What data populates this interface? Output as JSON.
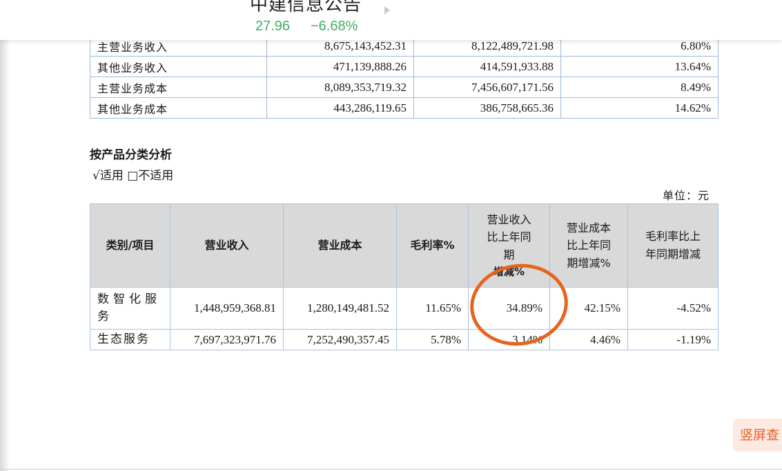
{
  "header": {
    "stock_name": "中建信息公告",
    "price": "27.96",
    "change": "−6.68%"
  },
  "summary_table": {
    "rows": [
      {
        "label": "主营业务收入",
        "current": "8,675,143,452.31",
        "previous": "8,122,489,721.98",
        "change": "6.80%"
      },
      {
        "label": "其他业务收入",
        "current": "471,139,888.26",
        "previous": "414,591,933.88",
        "change": "13.64%"
      },
      {
        "label": "主营业务成本",
        "current": "8,089,353,719.32",
        "previous": "7,456,607,171.56",
        "change": "8.49%"
      },
      {
        "label": "其他业务成本",
        "current": "443,286,119.65",
        "previous": "386,758,665.36",
        "change": "14.62%"
      }
    ]
  },
  "section": {
    "title": "按产品分类分析",
    "applicable": "√适用 □不适用",
    "unit": "单位：元"
  },
  "product_table": {
    "headers": {
      "category": "类别/项目",
      "revenue": "营业收入",
      "cost": "营业成本",
      "margin": "毛利率%",
      "revenue_change_l1": "营业收入",
      "revenue_change_l2": "比上年同",
      "revenue_change_l3": "期",
      "revenue_change_l4": "增减%",
      "cost_change_l1": "营业成本",
      "cost_change_l2": "比上年同",
      "cost_change_l3": "期增减%",
      "margin_change_l1": "毛利率比上",
      "margin_change_l2": "年同期增减"
    },
    "rows": [
      {
        "category_l1": "数智化服",
        "category_l2": "务",
        "revenue": "1,448,959,368.81",
        "cost": "1,280,149,481.52",
        "margin": "11.65%",
        "revenue_change": "34.89%",
        "cost_change": "42.15%",
        "margin_change": "-4.52%"
      },
      {
        "category": "生态服务",
        "revenue": "7,697,323,971.76",
        "cost": "7,252,490,357.45",
        "margin": "5.78%",
        "revenue_change": "3.14%",
        "cost_change": "4.46%",
        "margin_change": "-1.19%"
      }
    ]
  },
  "vertical_view_button": "竖屏查",
  "colors": {
    "stock_green": "#3fae6a",
    "circle_orange": "#e6651e",
    "table_border": "#9fb8d6",
    "header_gray": "#d9d9d9"
  }
}
